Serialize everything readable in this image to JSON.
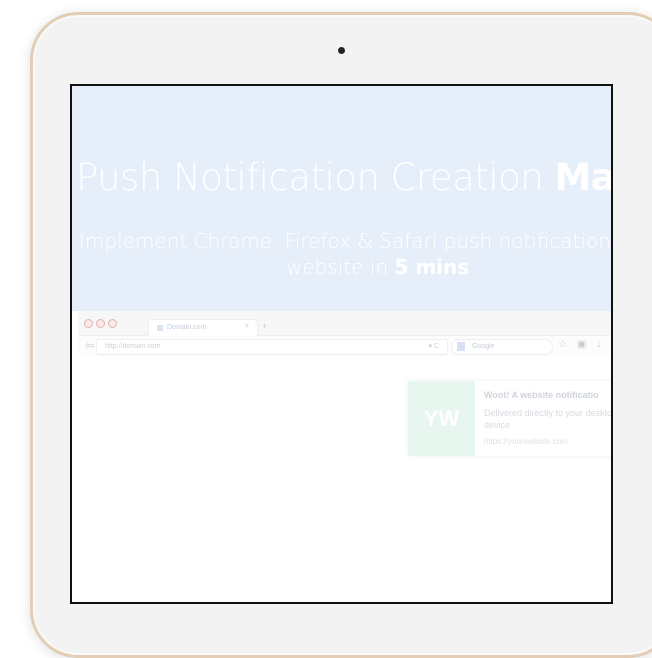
{
  "hero": {
    "title_light": "Push Notification Creation ",
    "title_bold": "Made E",
    "subtitle_line1": "Implement Chrome, Firefox & Safari push notifications o",
    "subtitle_line2_pre": "website in ",
    "subtitle_line2_bold": "5 mins"
  },
  "browser": {
    "tab_title": "Domain.com",
    "tab_close": "×",
    "new_tab": "+",
    "url": "http://domain.com",
    "search_placeholder": "Google"
  },
  "notification": {
    "logo_text": "YW",
    "title": "Woot! A website notificatio",
    "body": "Delivered directly to your desktop or device",
    "url": "https://yourwebsite.com"
  },
  "colors": {
    "hero_bg": "#e6eef9",
    "ipad_frame": "#e3cdb4",
    "logo_bg": "#e8f6f0"
  }
}
